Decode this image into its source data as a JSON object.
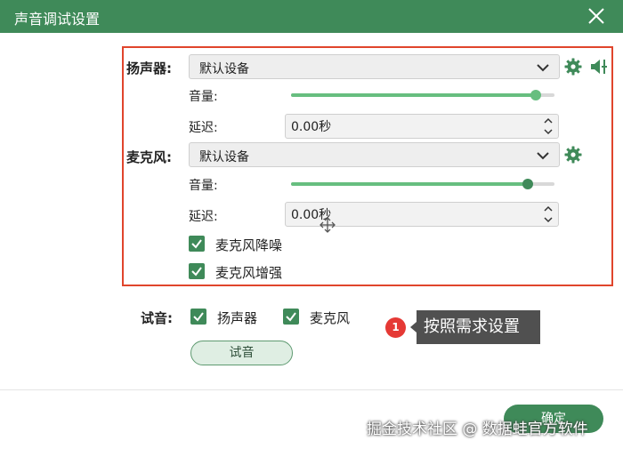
{
  "window": {
    "title": "声音调试设置",
    "close_icon": "close-icon"
  },
  "colors": {
    "accent": "#3f8a59",
    "slider_fill": "#67be7f",
    "highlight_border": "#e0452c",
    "badge": "#e53935",
    "tooltip_bg": "#505050"
  },
  "speaker": {
    "label": "扬声器:",
    "device": "默认设备",
    "volume_label": "音量:",
    "volume_level": 0.93,
    "delay_label": "延迟:",
    "delay_value": "0.00秒"
  },
  "microphone": {
    "label": "麦克风:",
    "device": "默认设备",
    "volume_label": "音量:",
    "volume_level": 0.9,
    "delay_label": "延迟:",
    "delay_value": "0.00秒",
    "noise_reduction_label": "麦克风降噪",
    "noise_reduction_checked": true,
    "enhance_label": "麦克风增强",
    "enhance_checked": true
  },
  "test": {
    "label": "试音:",
    "speaker_label": "扬声器",
    "speaker_checked": true,
    "mic_label": "麦克风",
    "mic_checked": true,
    "button_label": "试音"
  },
  "annotation": {
    "badge": "1",
    "tooltip": "按照需求设置"
  },
  "footer": {
    "confirm_label": "确定"
  },
  "watermark": "掘金技术社区 @ 数据蛙官方软件"
}
